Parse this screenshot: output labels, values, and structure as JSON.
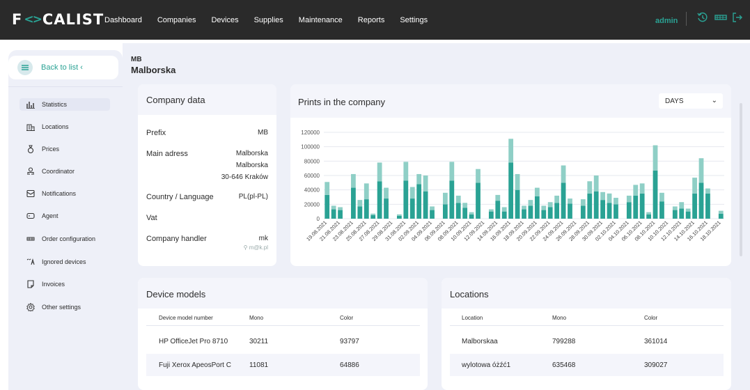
{
  "app": {
    "logo": "FOCALIST",
    "user": "admin"
  },
  "nav": [
    "Dashboard",
    "Companies",
    "Devices",
    "Supplies",
    "Maintenance",
    "Reports",
    "Settings"
  ],
  "sidebar": {
    "back": "Back to list ‹",
    "items": [
      "Statistics",
      "Locations",
      "Prices",
      "Coordinator",
      "Notifications",
      "Agent",
      "Order configuration",
      "Ignored devices",
      "Invoices",
      "Other settings"
    ]
  },
  "company": {
    "code": "MB",
    "name": "Malborska",
    "card_title": "Company data",
    "prefix_label": "Prefix",
    "prefix_value": "MB",
    "address_label": "Main adress",
    "address_line1": "Malborska",
    "address_line2": "Malborska",
    "address_line3": "30-646 Kraków",
    "country_label": "Country / Language",
    "country_value": "PL(pl-PL)",
    "vat_label": "Vat",
    "handler_label": "Company handler",
    "handler_value": "mk",
    "handler_email": "m@k.pl"
  },
  "prints": {
    "title": "Prints in the company",
    "period": "DAYS"
  },
  "chart_data": {
    "type": "bar",
    "title": "Prints in the company",
    "ylim": [
      0,
      120000
    ],
    "yticks": [
      0,
      20000,
      40000,
      60000,
      80000,
      100000,
      120000
    ],
    "x_tick_labels": [
      "19.08.2021",
      "21.08.2021",
      "23.08.2021",
      "25.08.2021",
      "27.08.2021",
      "29.08.2021",
      "31.08.2021",
      "02.09.2021",
      "04.09.2021",
      "06.09.2021",
      "08.09.2021",
      "10.09.2021",
      "12.09.2021",
      "14.09.2021",
      "16.09.2021",
      "18.09.2021",
      "20.09.2021",
      "22.09.2021",
      "24.09.2021",
      "26.09.2021",
      "28.09.2021",
      "30.09.2021",
      "02.10.2021",
      "04.10.2021",
      "06.10.2021",
      "08.10.2021",
      "10.10.2021",
      "12.10.2021",
      "14.10.2021",
      "16.10.2021",
      "18.10.2021"
    ],
    "series": [
      {
        "values": [
          33000,
          13000,
          12000,
          0,
          43000,
          17000,
          27000,
          5000,
          52000,
          28000,
          0,
          4000,
          53000,
          28000,
          48000,
          38000,
          12000,
          0,
          20000,
          53000,
          22000,
          15000,
          6000,
          50000,
          0,
          10000,
          25000,
          10000,
          78000,
          40000,
          13000,
          18000,
          31000,
          12000,
          16000,
          22000,
          50000,
          21000,
          0,
          18000,
          35000,
          38000,
          26000,
          22000,
          20000,
          0,
          23000,
          32000,
          35000,
          6000,
          67000,
          24000,
          0,
          12000,
          14000,
          10000,
          35000,
          50000,
          35000,
          0,
          7000
        ]
      },
      {
        "values": [
          18000,
          5000,
          4000,
          0,
          19000,
          9000,
          22000,
          2000,
          26000,
          15000,
          0,
          2000,
          26000,
          16000,
          14000,
          22000,
          5000,
          0,
          16000,
          26000,
          10000,
          7000,
          3000,
          19000,
          0,
          3000,
          8000,
          6000,
          33000,
          22000,
          5000,
          8000,
          12000,
          6000,
          7000,
          10000,
          24000,
          7000,
          0,
          9000,
          17000,
          22000,
          11000,
          13000,
          9000,
          0,
          9000,
          15000,
          14000,
          3000,
          35000,
          12000,
          0,
          5000,
          9000,
          4000,
          22000,
          34000,
          7000,
          0,
          4000
        ]
      }
    ]
  },
  "device_models": {
    "title": "Device models",
    "columns": [
      "Device model number",
      "Mono",
      "Color"
    ],
    "rows": [
      [
        "HP OfficeJet Pro 8710",
        "30211",
        "93797"
      ],
      [
        "Fuji Xerox ApeosPort C",
        "11081",
        "64886"
      ]
    ]
  },
  "locations": {
    "title": "Locations",
    "columns": [
      "Location",
      "Mono",
      "Color"
    ],
    "rows": [
      [
        "Malborskaa",
        "799288",
        "361014"
      ],
      [
        "wylotowa óżźć1",
        "635468",
        "309027"
      ]
    ]
  },
  "colors": {
    "accent": "#2aa294",
    "accent_light": "#8fcfc6",
    "topbar": "#2a2a2a",
    "panel": "#eef0f8"
  }
}
